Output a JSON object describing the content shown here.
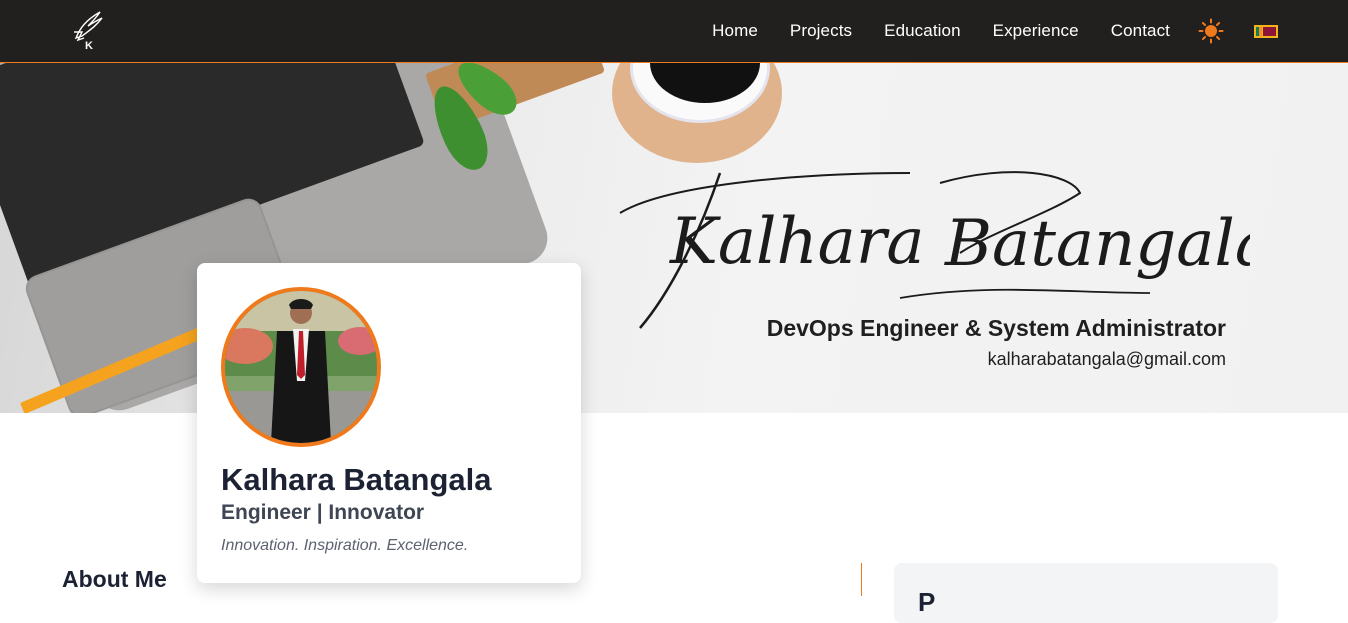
{
  "navbar": {
    "logo_icon": "k-logo-icon",
    "logo_letter": "K",
    "links": [
      "Home",
      "Projects",
      "Education",
      "Experience",
      "Contact"
    ],
    "theme_icon": "sun-icon",
    "language_icon": "sri-lanka-flag-icon",
    "accent_color": "#f07a1b",
    "background_color": "#221f1f"
  },
  "hero": {
    "signature": [
      "Kalhara",
      "Batangala"
    ],
    "role": "DevOps Engineer & System Administrator",
    "email": "kalharabatangala@gmail.com"
  },
  "profile": {
    "name": "Kalhara Batangala",
    "title": "Engineer | Innovator",
    "tagline": "Innovation. Inspiration. Excellence."
  },
  "sections": {
    "about_heading": "About Me",
    "side_card_heading": "P"
  }
}
